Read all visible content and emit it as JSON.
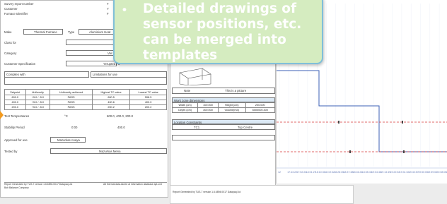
{
  "report": {
    "header_labels": [
      "Survey report number",
      "Customer",
      "Furnace Identifier"
    ],
    "header_values_partial": [
      "T",
      "Y",
      "F"
    ],
    "make_label": "Make",
    "make_value": "Thermal Furnace",
    "type_label": "Type",
    "type_value": "Aluminium Heat",
    "class_label": "Class for",
    "category_label": "Category",
    "category_value": "Vac",
    "customer_spec_label": "Customer Specification",
    "customer_spec_value": "Yerupted Fu",
    "complies_label": "Complies with",
    "limitations_label": "Limitations for use",
    "table": {
      "headers": [
        "Setpoint",
        "Uniformity",
        "Uniformity achieved",
        "Highest TC value",
        "Lowest TC value"
      ],
      "rows": [
        [
          "600.0",
          "+5.0 / -5.0",
          "PASS",
          "600.5",
          "598.5"
        ],
        [
          "400.0",
          "+5.0 / -5.0",
          "PASS",
          "400.6",
          "400.0"
        ],
        [
          "200.0",
          "+5.0 / -5.0",
          "PASS",
          "200.2",
          "200.2"
        ]
      ]
    },
    "test_temps_label": "Test Temperatures",
    "test_temps_unit": "°C",
    "test_temps_value": "600.0, 400.0, 200.0",
    "stability_label": "Stability Period",
    "stability_value": "0:00",
    "stability_value2": "400.0",
    "approved_label": "Approved for use",
    "approved_value": "Mazurkas Anaya",
    "tested_label": "Tested by",
    "tested_value": "Mazurkas Mena",
    "footer_left": "Report Generated by TUS-7 version 1.6.6894.0017 Datapaq Ltd",
    "footer_left2": "Bob Balance Company",
    "footer_right": "Alt thermal data-stored at information database apt-cmt"
  },
  "page2": {
    "picture_header": [
      "Note",
      "This is a picture"
    ],
    "work_zone_title": "Work zone dimensions",
    "dims": [
      [
        "Width (cm)",
        "100.000",
        "Height (cm)",
        "200.000"
      ],
      [
        "Depth (cm)",
        "300.000",
        "Volume(m3)",
        "6000000.300"
      ]
    ],
    "location_title": "Location Constraints",
    "location_row": [
      "TC1",
      "Top Centre"
    ]
  },
  "page3": {
    "footer": "Report Generated by TUS-7 version 1.6.6894.0017 Datapaq Ltd"
  },
  "callout": {
    "bullet": "•",
    "text": "Detailed drawings of sensor positions, etc. can be merged into templates"
  },
  "chart": {
    "x_ticks": [
      "12",
      "17:43:22",
      "17:52:24",
      "18:01:27",
      "18:10:30",
      "18:19:32",
      "18:28:35",
      "18:37:38",
      "18:46:41",
      "18:55:43",
      "19:04:46",
      "19:13:49",
      "19:22:52",
      "19:31:54",
      "19:40:57",
      "19:50:00",
      "19:59:02",
      "20:08:05",
      "20:17"
    ],
    "colors": {
      "blue": "#3b5fb5",
      "red": "#d9383a",
      "grid": "#9fb1d8"
    }
  }
}
